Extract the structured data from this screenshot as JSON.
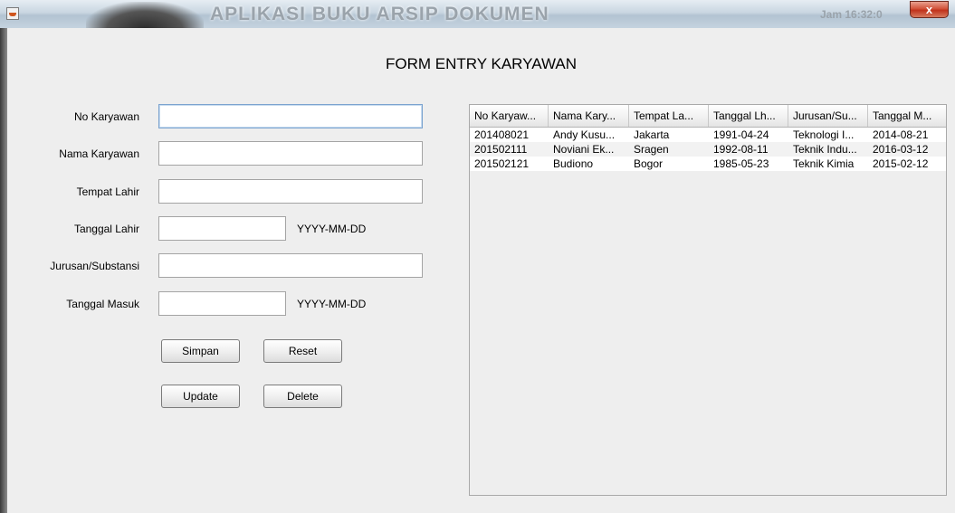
{
  "window": {
    "title": "APLIKASI BUKU ARSIP DOKUMEN",
    "clock": "Jam 16:32:0",
    "close_glyph": "x"
  },
  "form": {
    "title": "FORM ENTRY KARYAWAN",
    "fields": {
      "no_karyawan": {
        "label": "No Karyawan",
        "value": ""
      },
      "nama_karyawan": {
        "label": "Nama Karyawan",
        "value": ""
      },
      "tempat_lahir": {
        "label": "Tempat Lahir",
        "value": ""
      },
      "tanggal_lahir": {
        "label": "Tanggal Lahir",
        "value": "",
        "hint": "YYYY-MM-DD"
      },
      "jurusan": {
        "label": "Jurusan/Substansi",
        "value": ""
      },
      "tanggal_masuk": {
        "label": "Tanggal Masuk",
        "value": "",
        "hint": "YYYY-MM-DD"
      }
    },
    "buttons": {
      "simpan": "Simpan",
      "reset": "Reset",
      "update": "Update",
      "delete": "Delete"
    }
  },
  "table": {
    "columns": [
      "No Karyaw...",
      "Nama Kary...",
      "Tempat La...",
      "Tanggal Lh...",
      "Jurusan/Su...",
      "Tanggal M..."
    ],
    "rows": [
      [
        "201408021",
        "Andy Kusu...",
        "Jakarta",
        "1991-04-24",
        "Teknologi I...",
        "2014-08-21"
      ],
      [
        "201502111",
        "Noviani Ek...",
        "Sragen",
        "1992-08-11",
        "Teknik Indu...",
        "2016-03-12"
      ],
      [
        "201502121",
        "Budiono",
        "Bogor",
        "1985-05-23",
        "Teknik Kimia",
        "2015-02-12"
      ]
    ]
  },
  "icons": {
    "app": "java-cup-icon",
    "close": "close-icon"
  }
}
